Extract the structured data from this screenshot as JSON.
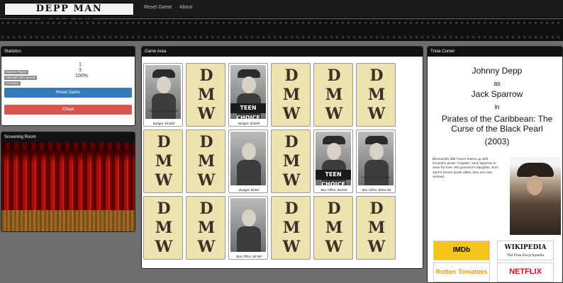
{
  "nav": {
    "brand": "DEPP MAN WALKING",
    "links": [
      "Reset Game",
      "About"
    ]
  },
  "statistics": {
    "title": "Statistics",
    "rows": [
      {
        "label": "Games Played",
        "value": "1"
      },
      {
        "label": "Attempts (this game)",
        "value": "3"
      },
      {
        "label": "Accuracy",
        "value": "100%"
      }
    ],
    "reset_button": "Reset Game",
    "cheat_button": "Cheat"
  },
  "screening": {
    "title": "Screening Room"
  },
  "game": {
    "title": "Game Area",
    "back_letters": [
      "D",
      "M",
      "W"
    ],
    "cards": [
      {
        "state": "face",
        "kind": "pirate",
        "badge": "People's Choice Award",
        "caption": "Budget: $140M"
      },
      {
        "state": "back"
      },
      {
        "state": "face",
        "kind": "hatter",
        "badge": "TEEN CHOICE",
        "caption": "Budget: $150M"
      },
      {
        "state": "back"
      },
      {
        "state": "back"
      },
      {
        "state": "back"
      },
      {
        "state": "back"
      },
      {
        "state": "back"
      },
      {
        "state": "face",
        "kind": "man",
        "badge": "",
        "caption": "Budget: $18M"
      },
      {
        "state": "back"
      },
      {
        "state": "face",
        "kind": "hatter",
        "badge": "TEEN CHOICE",
        "caption": "Box Office: $415M"
      },
      {
        "state": "face",
        "kind": "pirate",
        "badge": "People's Choice Award",
        "caption": "Box Office: $654.3M"
      },
      {
        "state": "back"
      },
      {
        "state": "back"
      },
      {
        "state": "face",
        "kind": "man",
        "badge": "",
        "caption": "Box Office: $5.9M"
      },
      {
        "state": "back"
      },
      {
        "state": "back"
      },
      {
        "state": "back"
      }
    ]
  },
  "trivia": {
    "title": "Trivia Corner",
    "actor": "Johnny Depp",
    "as": "as",
    "role": "Jack Sparrow",
    "in": "in",
    "movie": "Pirates of the Caribbean: The Curse of the Black Pearl",
    "year": "(2003)",
    "description": "Blacksmith Will Turner teams up with eccentric pirate \"Captain\" Jack Sparrow to save his love, the governor's daughter, from Jack's former pirate allies, who are now undead.",
    "logos": {
      "imdb": "IMDb",
      "wikipedia": "WIKIPEDIA",
      "wikipedia_sub": "The Free Encyclopedia",
      "rotten_tomatoes": "Rotten Tomatoes",
      "netflix": "NETFLIX"
    }
  }
}
